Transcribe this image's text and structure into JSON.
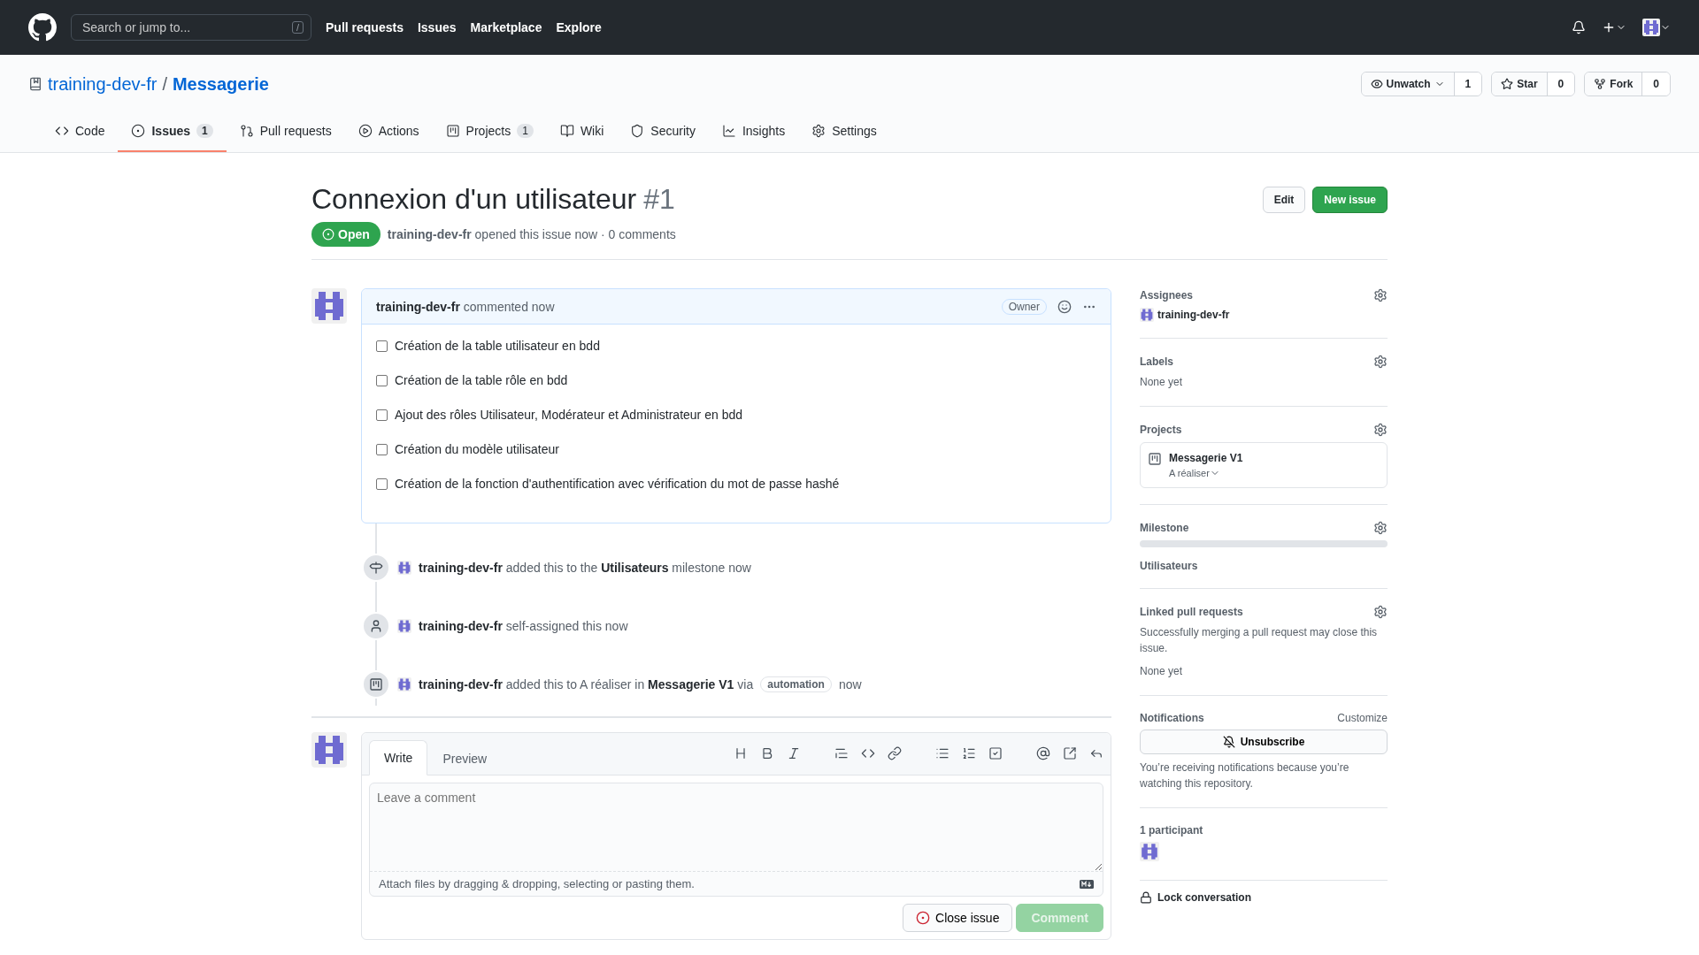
{
  "topbar": {
    "search_placeholder": "Search or jump to...",
    "search_key": "/",
    "nav": [
      "Pull requests",
      "Issues",
      "Marketplace",
      "Explore"
    ]
  },
  "repo": {
    "owner": "training-dev-fr",
    "separator": "/",
    "name": "Messagerie",
    "actions": [
      {
        "label": "Unwatch",
        "kind": "watch",
        "count": "1"
      },
      {
        "label": "Star",
        "kind": "star",
        "count": "0"
      },
      {
        "label": "Fork",
        "kind": "fork",
        "count": "0"
      }
    ]
  },
  "tabs": [
    {
      "label": "Code",
      "kind": "code",
      "selected": false
    },
    {
      "label": "Issues",
      "kind": "issues",
      "counter": "1",
      "selected": true
    },
    {
      "label": "Pull requests",
      "kind": "pulls",
      "selected": false
    },
    {
      "label": "Actions",
      "kind": "actions",
      "selected": false
    },
    {
      "label": "Projects",
      "kind": "projects",
      "counter": "1",
      "selected": false
    },
    {
      "label": "Wiki",
      "kind": "wiki",
      "selected": false
    },
    {
      "label": "Security",
      "kind": "security",
      "selected": false
    },
    {
      "label": "Insights",
      "kind": "insights",
      "selected": false
    },
    {
      "label": "Settings",
      "kind": "settings",
      "selected": false
    }
  ],
  "issue": {
    "title": "Connexion d'un utilisateur",
    "number": "#1",
    "state": "Open",
    "author": "training-dev-fr",
    "meta": "opened this issue now · 0 comments",
    "edit": "Edit",
    "new_issue": "New issue"
  },
  "comment": {
    "author": "training-dev-fr",
    "action": "commented now",
    "role": "Owner",
    "tasks": [
      {
        "text": "Création de la table utilisateur en bdd",
        "checked": false
      },
      {
        "text": "Création de la table rôle en bdd",
        "checked": false
      },
      {
        "text": "Ajout des rôles Utilisateur, Modérateur et Administrateur en bdd",
        "checked": false
      },
      {
        "text": "Création du modèle utilisateur",
        "checked": false
      },
      {
        "text": "Création de la fonction d'authentification avec vérification du mot de passe hashé",
        "checked": false
      }
    ]
  },
  "events": [
    {
      "kind": "milestone",
      "actor": "training-dev-fr",
      "text": "added this to the **Utilisateurs** milestone now"
    },
    {
      "kind": "assigned",
      "actor": "training-dev-fr",
      "text": "self-assigned this now"
    },
    {
      "kind": "project",
      "actor": "training-dev-fr",
      "text": "added this to A réaliser in **Messagerie V1** via",
      "badge": "automation",
      "after": "now"
    }
  ],
  "composer": {
    "tabs": [
      {
        "label": "Write",
        "selected": true
      },
      {
        "label": "Preview",
        "selected": false
      }
    ],
    "placeholder": "Leave a comment",
    "attach_hint": "Attach files by dragging & dropping, selecting or pasting them.",
    "close_button": "Close issue",
    "comment_button": "Comment",
    "comment_disabled": true
  },
  "sidebar": {
    "assignees": {
      "title": "Assignees",
      "users": [
        "training-dev-fr"
      ]
    },
    "labels": {
      "title": "Labels",
      "empty": "None yet"
    },
    "projects": {
      "title": "Projects",
      "name": "Messagerie V1",
      "column": "A réaliser"
    },
    "milestone": {
      "title": "Milestone",
      "level": 0,
      "name": "Utilisateurs"
    },
    "linked": {
      "title": "Linked pull requests",
      "note": "Successfully merging a pull request may close this issue.",
      "empty": "None yet"
    },
    "notifications": {
      "title": "Notifications",
      "customize": "Customize",
      "button": "Unsubscribe",
      "note": "You’re receiving notifications because you’re watching this repository."
    },
    "participants": {
      "title": "1 participant"
    },
    "lock": "Lock conversation"
  }
}
